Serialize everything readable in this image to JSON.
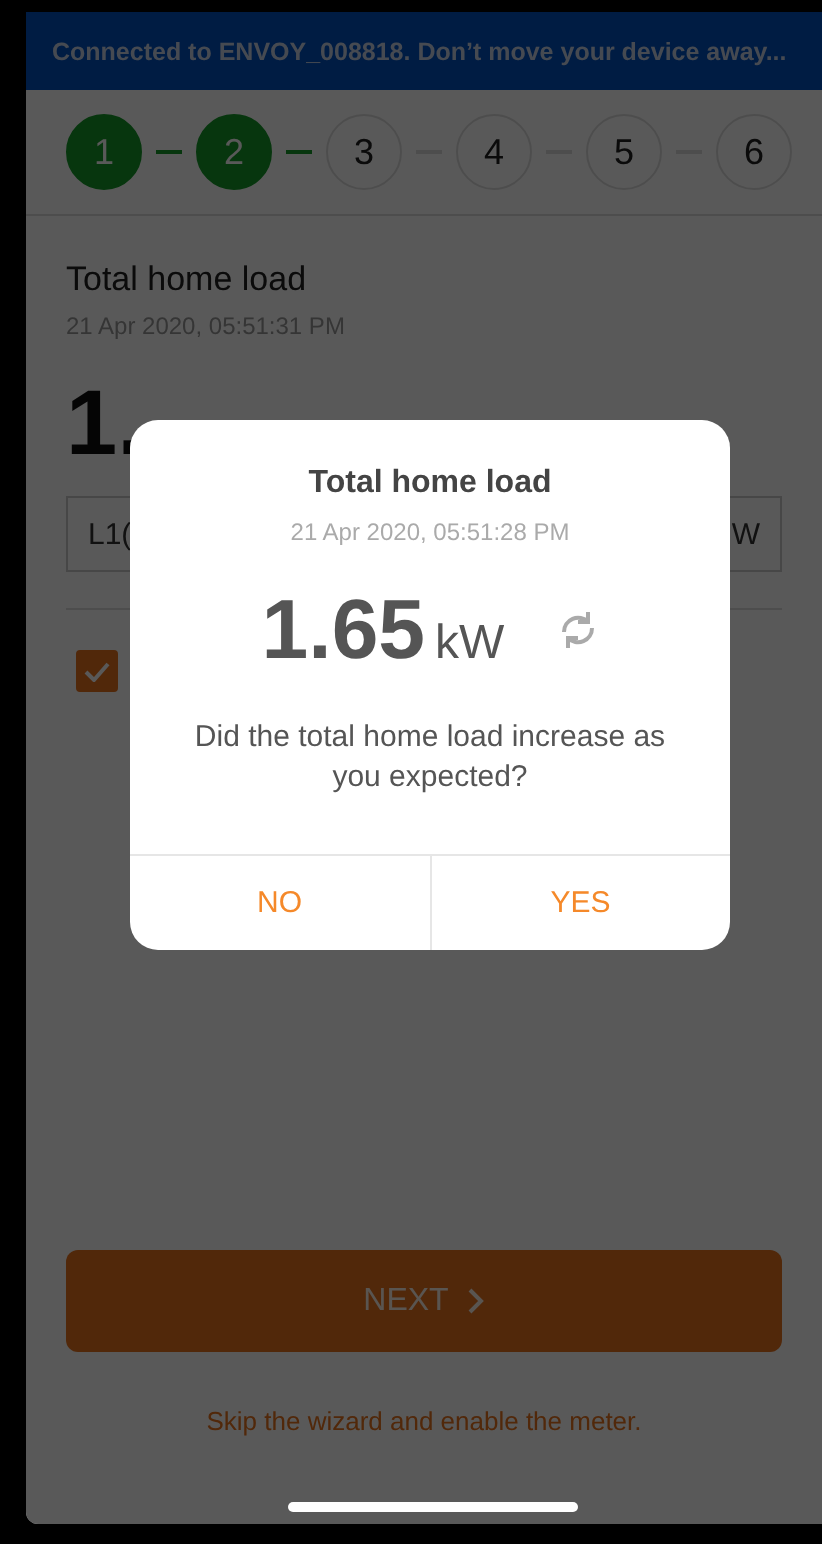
{
  "banner": {
    "text": "Connected to ENVOY_008818. Don’t move your device away..."
  },
  "steps": [
    {
      "label": "1",
      "done": true
    },
    {
      "label": "2",
      "done": true
    },
    {
      "label": "3",
      "done": false
    },
    {
      "label": "4",
      "done": false
    },
    {
      "label": "5",
      "done": false
    },
    {
      "label": "6",
      "done": false
    }
  ],
  "reading": {
    "title": "Total home load",
    "timestamp": "21 Apr 2020, 05:51:31 PM",
    "value": "1.",
    "phase_label": "L1(",
    "phase_value": "W"
  },
  "confirm": {
    "checked": true
  },
  "next_button": {
    "label": "NEXT"
  },
  "skip_link": "Skip the wizard and enable the meter.",
  "dialog": {
    "title": "Total home load",
    "timestamp": "21 Apr 2020, 05:51:28 PM",
    "value": "1.65",
    "unit": "kW",
    "question": "Did the total home load increase as you expected?",
    "buttons": [
      "NO",
      "YES"
    ]
  }
}
